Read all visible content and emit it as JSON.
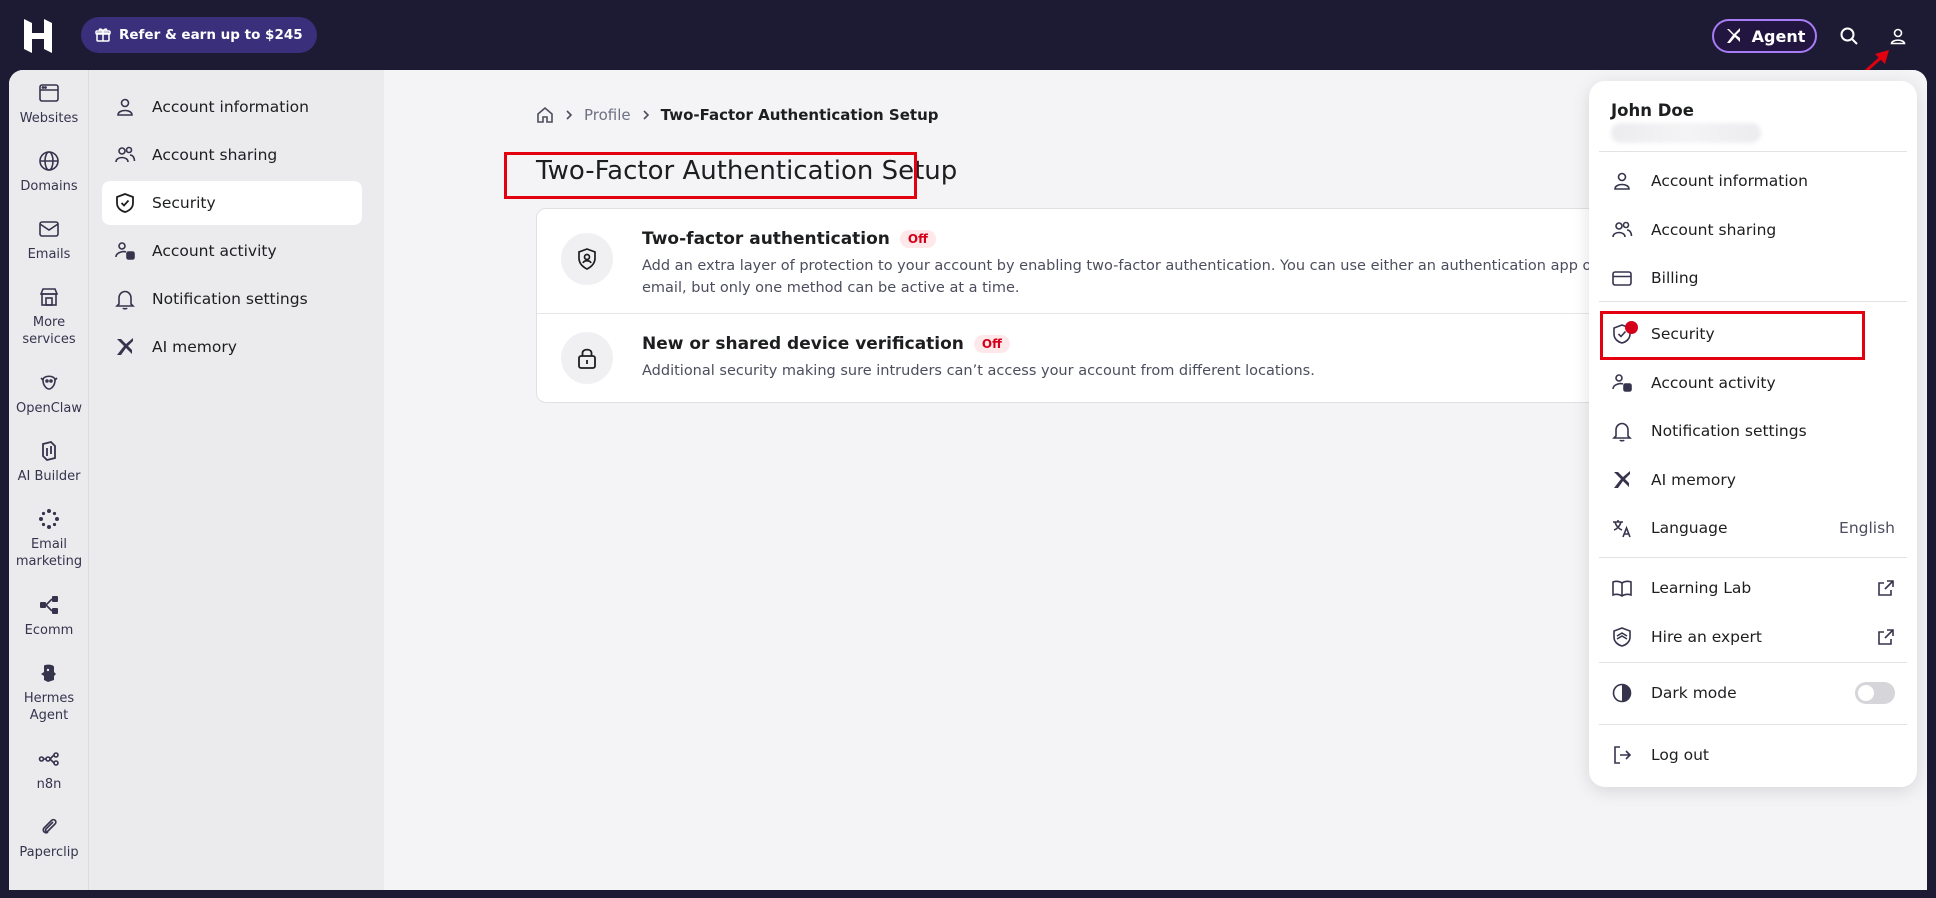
{
  "topbar": {
    "refer_label": "Refer & earn up to $245",
    "agent_label": "Agent"
  },
  "rail": {
    "items": [
      {
        "label": "Websites",
        "icon": "browser-icon"
      },
      {
        "label": "Domains",
        "icon": "globe-icon"
      },
      {
        "label": "Emails",
        "icon": "mail-icon"
      },
      {
        "label": "More services",
        "icon": "store-icon"
      },
      {
        "label": "OpenClaw",
        "icon": "claw-icon"
      },
      {
        "label": "AI Builder",
        "icon": "ai-builder-icon"
      },
      {
        "label": "Email marketing",
        "icon": "email-marketing-icon"
      },
      {
        "label": "Ecomm",
        "icon": "ecomm-icon"
      },
      {
        "label": "Hermes Agent",
        "icon": "hermes-icon"
      },
      {
        "label": "n8n",
        "icon": "n8n-icon"
      },
      {
        "label": "Paperclip",
        "icon": "paperclip-icon"
      }
    ]
  },
  "subnav": {
    "items": [
      {
        "label": "Account information",
        "icon": "user-icon"
      },
      {
        "label": "Account sharing",
        "icon": "users-icon"
      },
      {
        "label": "Security",
        "icon": "shield-icon",
        "active": true
      },
      {
        "label": "Account activity",
        "icon": "user-activity-icon"
      },
      {
        "label": "Notification settings",
        "icon": "bell-icon"
      },
      {
        "label": "AI memory",
        "icon": "ai-memory-icon"
      }
    ]
  },
  "breadcrumb": {
    "profile": "Profile",
    "current": "Two-Factor Authentication Setup"
  },
  "page": {
    "title": "Two-Factor Authentication Setup"
  },
  "card": {
    "rows": [
      {
        "title": "Two-factor authentication",
        "badge": "Off",
        "desc_line1": "Add an extra layer of protection to your account by enabling two-factor authentication. You can use either an authentication app or",
        "desc_line2": "email, but only one method can be active at a time."
      },
      {
        "title": "New or shared device verification",
        "badge": "Off",
        "desc_line1": "Additional security making sure intruders can’t access your account from different locations."
      }
    ]
  },
  "menu": {
    "user_name": "John Doe",
    "items": {
      "account_information": "Account information",
      "account_sharing": "Account sharing",
      "billing": "Billing",
      "security": "Security",
      "account_activity": "Account activity",
      "notification_settings": "Notification settings",
      "ai_memory": "AI memory",
      "language": "Language",
      "language_value": "English",
      "learning_lab": "Learning Lab",
      "hire_expert": "Hire an expert",
      "dark_mode": "Dark mode",
      "log_out": "Log out"
    },
    "dark_mode_on": false
  },
  "colors": {
    "topbar_bg": "#1d1b33",
    "accent_purple": "#a77cf7",
    "highlight_red": "#e3000f",
    "badge_red": "#d4001a"
  }
}
